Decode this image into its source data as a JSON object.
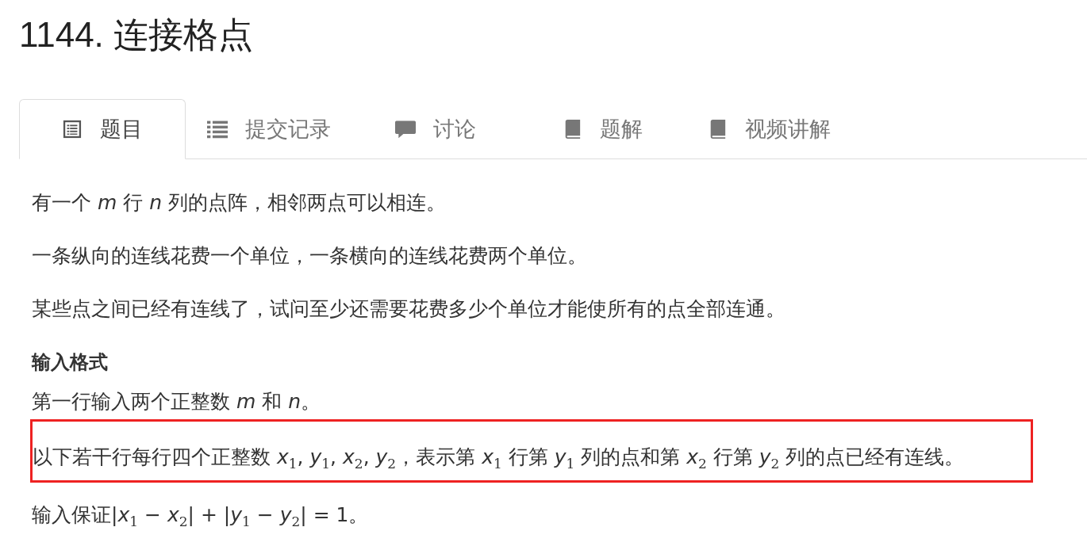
{
  "title": "1144. 连接格点",
  "tabs": [
    {
      "label": "题目",
      "selected": true
    },
    {
      "label": "提交记录",
      "selected": false
    },
    {
      "label": "讨论",
      "selected": false
    },
    {
      "label": "题解",
      "selected": false
    },
    {
      "label": "视频讲解",
      "selected": false
    }
  ],
  "content": [
    {
      "kind": "paragraph",
      "text": "有一个 *m* 行 *n* 列的点阵，相邻两点可以相连。"
    },
    {
      "kind": "paragraph",
      "text": "一条纵向的连线花费一个单位，一条横向的连线花费两个单位。"
    },
    {
      "kind": "paragraph",
      "text": "某些点之间已经有连线了，试问至少还需要花费多少个单位才能使所有的点全部连通。"
    },
    {
      "kind": "heading",
      "text": "输入格式"
    },
    {
      "kind": "paragraph",
      "text": "第一行输入两个正整数 *m* 和 *n*。"
    },
    {
      "kind": "paragraph",
      "text": "以下若干行每行四个正整数 *x*$_{1}$, *y*$_{1}$, *x*$_{2}$, *y*$_{2}$，表示第 *x*$_{1}$ 行第 *y*$_{1}$ 列的点和第 *x*$_{2}$ 行第 *y*$_{2}$ 列的点已经有连线。",
      "highlighted": true
    },
    {
      "kind": "paragraph",
      "text": "输入保证|*x*$_{1}$ − *x*$_{2}$| + |*y*$_{1}$ − *y*$_{2}$| = 1。"
    }
  ]
}
